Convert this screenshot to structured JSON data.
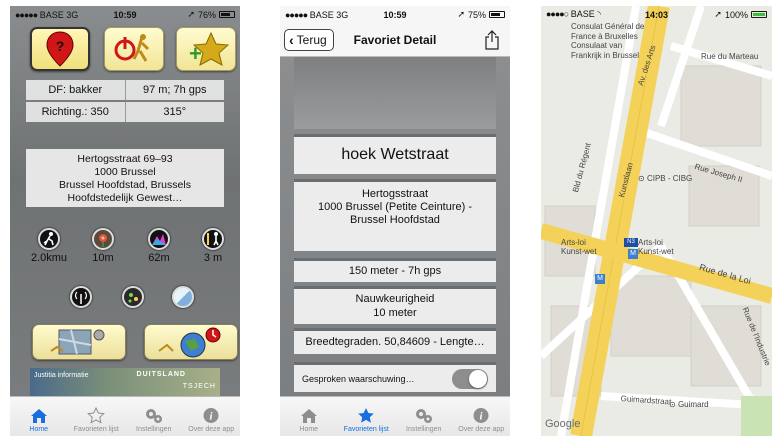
{
  "screen1": {
    "status": {
      "carrier": "BASE",
      "network": "3G",
      "time": "10:59",
      "battery": "76%"
    },
    "row_df": {
      "left": "DF: bakker",
      "right": "97 m; 7h gps"
    },
    "row_dir": {
      "left": "Richting.: 350",
      "right": "315°"
    },
    "address": {
      "line1": "Hertogsstraat 69–93",
      "line2": "1000 Brussel",
      "line3": "Brussel Hoofdstad, Brussels",
      "line4": "Hoofdstedelijk Gewest…"
    },
    "gauges": [
      {
        "name": "speed",
        "label": "2.0kmu"
      },
      {
        "name": "precision",
        "label": "10m"
      },
      {
        "name": "altitude",
        "label": "62m"
      },
      {
        "name": "accuracy",
        "label": "3 m"
      }
    ],
    "map_strip": {
      "text1": "Justitia informatie",
      "text2": "DUITSLAND",
      "text3": "TSJECH"
    },
    "tabs": [
      {
        "label": "Home",
        "icon": "house-icon",
        "active": true
      },
      {
        "label": "Favorieten lijst",
        "icon": "star-icon",
        "active": false
      },
      {
        "label": "Instellingen",
        "icon": "gears-icon",
        "active": false
      },
      {
        "label": "Over deze app",
        "icon": "info-icon",
        "active": false
      }
    ]
  },
  "screen2": {
    "status": {
      "carrier": "BASE",
      "network": "3G",
      "time": "10:59",
      "battery": "75%"
    },
    "nav": {
      "back_label": "Terug",
      "title": "Favoriet Detail"
    },
    "name": "hoek Wetstraat",
    "address": {
      "line1": "Hertogsstraat",
      "line2": "1000  Brussel (Petite Ceinture) -",
      "line3": "Brussel Hoofdstad"
    },
    "distance": "150 meter - 7h gps",
    "accuracy": {
      "title": "Nauwkeurigheid",
      "value": "10 meter"
    },
    "coords": "Breedtegraden. 50,84609 - Lengte…",
    "voice_warning": {
      "label": "Gesproken waarschuwing…",
      "on": false
    },
    "tabs": [
      {
        "label": "Home",
        "icon": "house-icon",
        "active": false
      },
      {
        "label": "Favorieten lijst",
        "icon": "star-icon",
        "active": true
      },
      {
        "label": "Instellingen",
        "icon": "gears-icon",
        "active": false
      },
      {
        "label": "Over deze app",
        "icon": "info-icon",
        "active": false
      }
    ]
  },
  "screen3": {
    "status": {
      "carrier": "BASE",
      "time": "14:03",
      "battery": "100%"
    },
    "labels": {
      "consulate": "Consulat Général de France à Bruxelles Consulaat van Frankrijk in Brussel",
      "rue_marteau": "Rue du Marteau",
      "av_arts": "Av. des Arts",
      "bld_regent": "Bld du Régent",
      "kunstlaan": "Kunstlaan",
      "cipb": "CIPB - CIBG",
      "rue_joseph": "Rue Joseph II",
      "arts_loi_1": "Arts-loi",
      "kunst_wet_1": "Kunst-wet",
      "arts_loi_2": "Arts-loi",
      "kunst_wet_2": "Kunst-wet",
      "metro_line": "N3",
      "rue_loi": "Rue de la Loi",
      "rue_industrie": "Rue de l'Industrie",
      "guimardstraat": "Guimardstraat",
      "guimard": "Guimard",
      "google": "Google"
    }
  }
}
